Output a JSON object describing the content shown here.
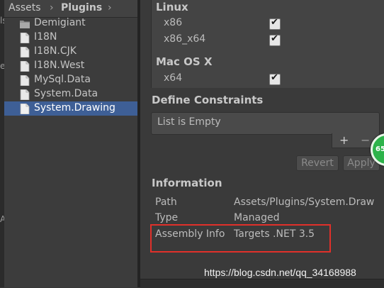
{
  "breadcrumb": {
    "root": "Assets",
    "separator": "›",
    "current": "Plugins"
  },
  "project_items": [
    {
      "label": "Demigiant",
      "type": "folder",
      "selected": false
    },
    {
      "label": "I18N",
      "type": "file",
      "selected": false
    },
    {
      "label": "I18N.CJK",
      "type": "file",
      "selected": false
    },
    {
      "label": "I18N.West",
      "type": "file",
      "selected": false
    },
    {
      "label": "MySql.Data",
      "type": "file",
      "selected": false
    },
    {
      "label": "System.Data",
      "type": "file",
      "selected": false
    },
    {
      "label": "System.Drawing",
      "type": "file",
      "selected": true
    }
  ],
  "edge_chars": [
    "ls",
    "e",
    "A"
  ],
  "platforms": {
    "linux": {
      "title": "Linux",
      "x86": "x86",
      "x86_64": "x86_x64",
      "x86_checked": true,
      "x86_64_checked": true
    },
    "mac": {
      "title": "Mac OS X",
      "x64": "x64",
      "x64_checked": true
    }
  },
  "define_constraints": {
    "title": "Define Constraints",
    "empty_text": "List is Empty",
    "add": "+",
    "remove": "−"
  },
  "buttons": {
    "revert": "Revert",
    "apply": "Apply"
  },
  "badge_text": "65",
  "information": {
    "title": "Information",
    "rows": [
      {
        "key": "Path",
        "value": "Assets/Plugins/System.Draw"
      },
      {
        "key": "Type",
        "value": "Managed"
      },
      {
        "key": "Assembly Info",
        "value": "Targets .NET 3.5"
      }
    ]
  },
  "watermark": "https://blog.csdn.net/qq_34168988",
  "colors": {
    "selection": "#3e5f96",
    "highlight_border": "#e0302a",
    "badge": "#2db34a"
  }
}
